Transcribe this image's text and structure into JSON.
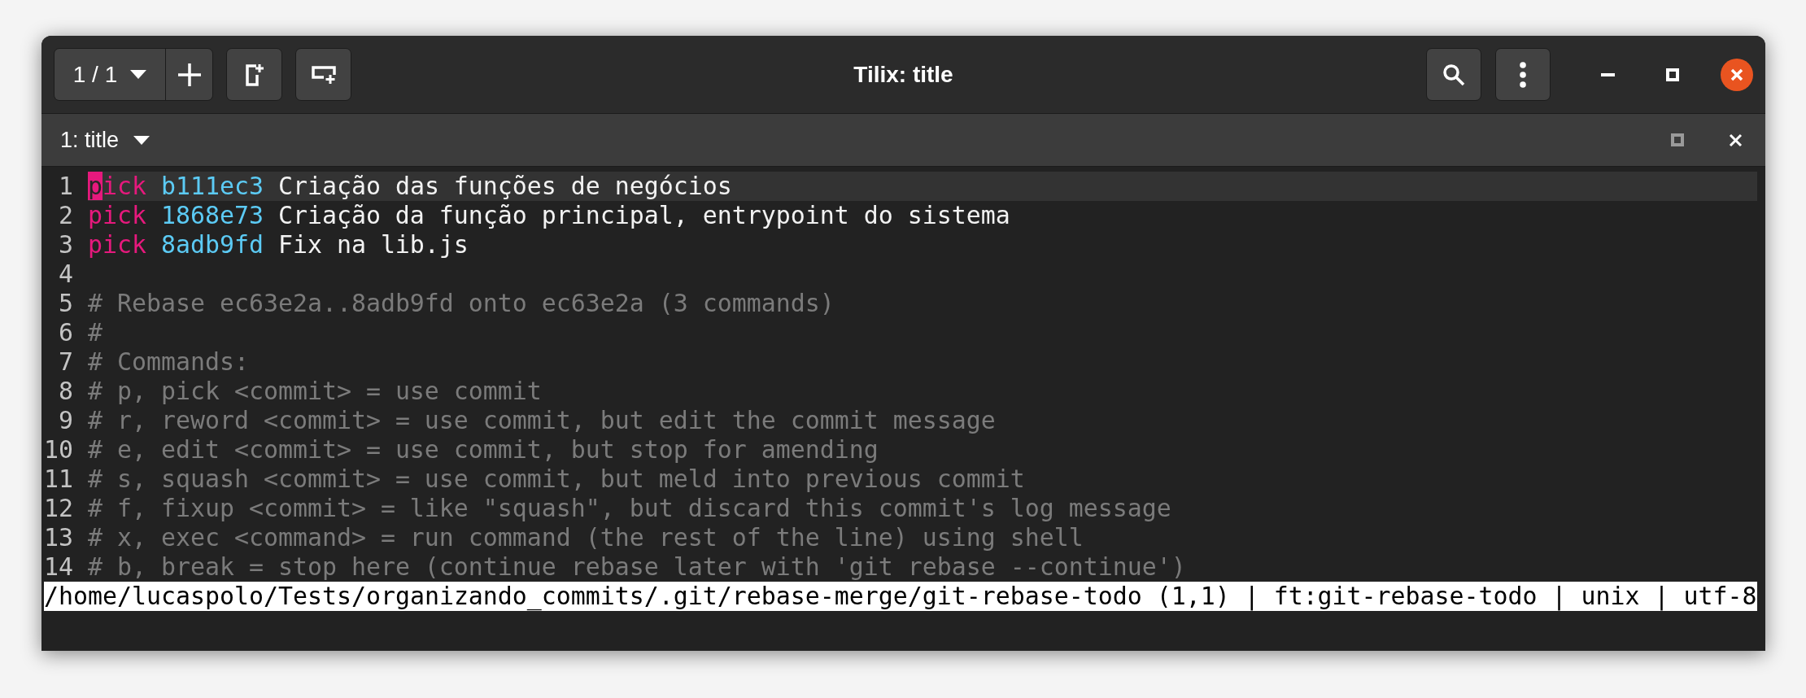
{
  "window": {
    "title": "Tilix: title"
  },
  "toolbar": {
    "session_selector": "1 / 1"
  },
  "terminal_tab": {
    "title": "1: title"
  },
  "editor": {
    "lines": [
      {
        "number": "1",
        "current": true,
        "segments": [
          {
            "kind": "keyword",
            "text": "pick",
            "cursor": true
          },
          {
            "kind": "hash",
            "text": "b111ec3"
          },
          {
            "kind": "text",
            "text": "Criação das funções de negócios"
          }
        ]
      },
      {
        "number": "2",
        "current": false,
        "segments": [
          {
            "kind": "keyword",
            "text": "pick"
          },
          {
            "kind": "hash",
            "text": "1868e73"
          },
          {
            "kind": "text",
            "text": "Criação da função principal, entrypoint do sistema"
          }
        ]
      },
      {
        "number": "3",
        "current": false,
        "segments": [
          {
            "kind": "keyword",
            "text": "pick"
          },
          {
            "kind": "hash",
            "text": "8adb9fd"
          },
          {
            "kind": "text",
            "text": "Fix na lib.js"
          }
        ]
      },
      {
        "number": "4",
        "current": false
      },
      {
        "number": "5",
        "current": false,
        "segments": [
          {
            "kind": "comment",
            "text": "# Rebase ec63e2a..8adb9fd onto ec63e2a (3 commands)"
          }
        ]
      },
      {
        "number": "6",
        "current": false,
        "segments": [
          {
            "kind": "comment",
            "text": "#"
          }
        ]
      },
      {
        "number": "7",
        "current": false,
        "segments": [
          {
            "kind": "comment",
            "text": "# Commands:"
          }
        ]
      },
      {
        "number": "8",
        "current": false,
        "segments": [
          {
            "kind": "comment",
            "text": "# p, pick <commit> = use commit"
          }
        ]
      },
      {
        "number": "9",
        "current": false,
        "segments": [
          {
            "kind": "comment",
            "text": "# r, reword <commit> = use commit, but edit the commit message"
          }
        ]
      },
      {
        "number": "10",
        "current": false,
        "segments": [
          {
            "kind": "comment",
            "text": "# e, edit <commit> = use commit, but stop for amending"
          }
        ]
      },
      {
        "number": "11",
        "current": false,
        "segments": [
          {
            "kind": "comment",
            "text": "# s, squash <commit> = use commit, but meld into previous commit"
          }
        ]
      },
      {
        "number": "12",
        "current": false,
        "segments": [
          {
            "kind": "comment",
            "text": "# f, fixup <commit> = like \"squash\", but discard this commit's log message"
          }
        ]
      },
      {
        "number": "13",
        "current": false,
        "segments": [
          {
            "kind": "comment",
            "text": "# x, exec <command> = run command (the rest of the line) using shell"
          }
        ]
      },
      {
        "number": "14",
        "current": false,
        "segments": [
          {
            "kind": "comment",
            "text": "# b, break = stop here (continue rebase later with 'git rebase --continue')"
          }
        ]
      }
    ],
    "status_line": "/home/lucaspolo/Tests/organizando_commits/.git/rebase-merge/git-rebase-todo (1,1) | ft:git-rebase-todo | unix | utf-8"
  }
}
